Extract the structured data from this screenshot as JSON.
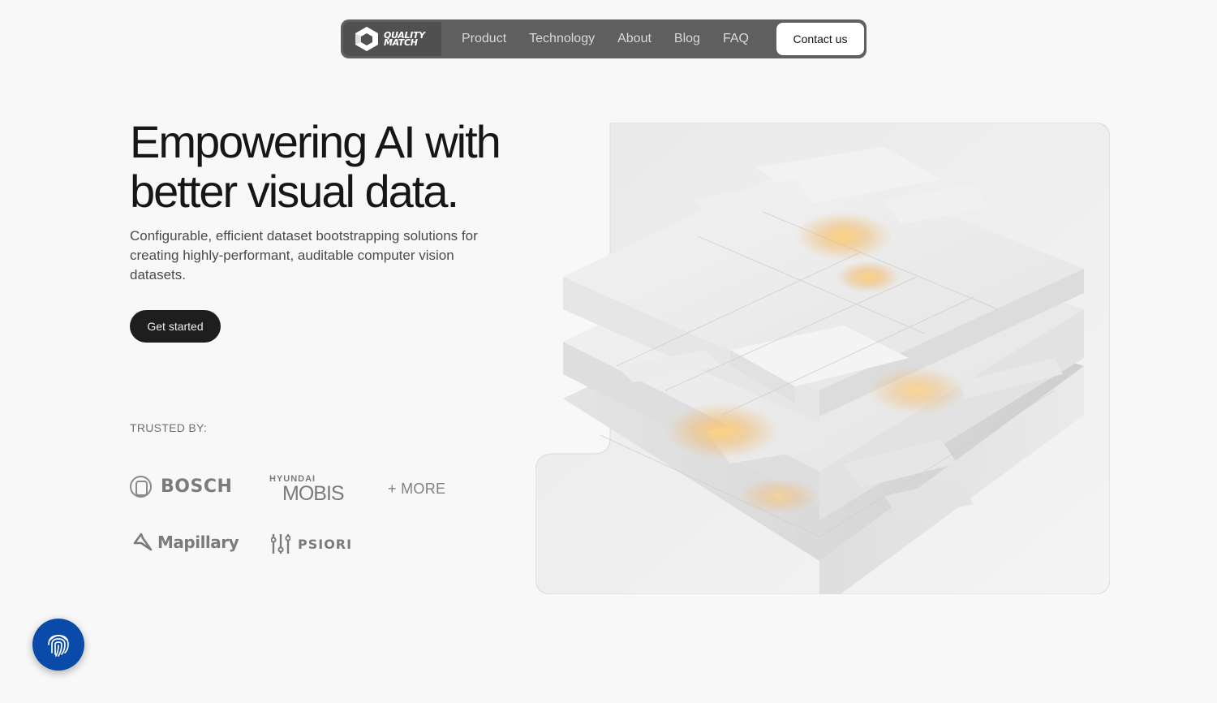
{
  "nav": {
    "logo_line1": "QUALITY",
    "logo_line2": "MATCH",
    "links": [
      "Product",
      "Technology",
      "About",
      "Blog",
      "FAQ"
    ],
    "contact_label": "Contact us"
  },
  "hero": {
    "title_line1": "Empowering AI with",
    "title_line2": "better visual data.",
    "subtitle": "Configurable, efficient dataset bootstrapping solutions for creating highly-performant, auditable computer vision datasets.",
    "cta_label": "Get started"
  },
  "trusted": {
    "heading": "TRUSTED BY:",
    "bosch": "BOSCH",
    "hyundai": "HYUNDAI",
    "mobis": "MOBIS",
    "more": "+ MORE",
    "mapillary": "Mapillary",
    "psiori": "PSIORI"
  },
  "icons": {
    "logo": "quality-match-logo-icon",
    "fab": "fingerprint-icon"
  },
  "colors": {
    "nav_bg": "#5f5f5f",
    "cta_bg": "#1e1e1e",
    "fab_bg": "#0a4aa8"
  }
}
